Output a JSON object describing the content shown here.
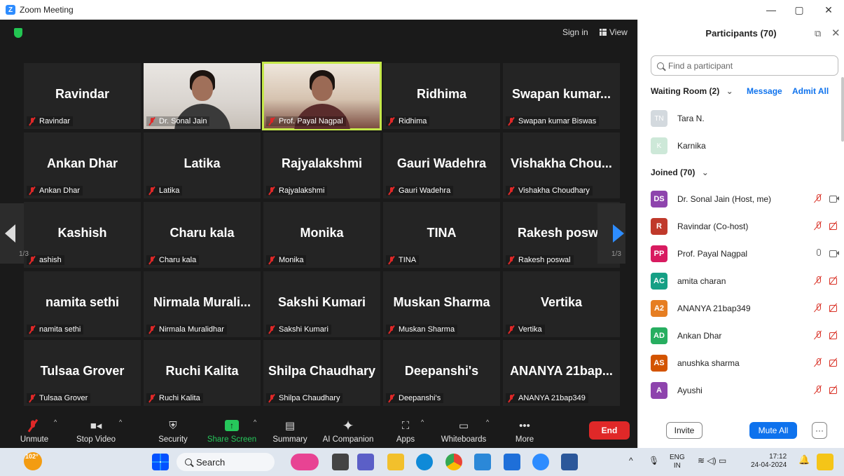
{
  "window": {
    "title": "Zoom Meeting",
    "minimize": "—",
    "restore": "▢",
    "close": "✕",
    "logo_letter": "Z"
  },
  "meeting": {
    "sign_in": "Sign in",
    "view": "View",
    "page_indicator": "1/3",
    "tiles": [
      {
        "big": "Ravindar",
        "name": "Ravindar"
      },
      {
        "big": "",
        "name": "Dr. Sonal Jain",
        "video": true
      },
      {
        "big": "",
        "name": "Prof. Payal Nagpal",
        "video": true
      },
      {
        "big": "Ridhima",
        "name": "Ridhima"
      },
      {
        "big": "Swapan  kumar...",
        "name": "Swapan kumar Biswas"
      },
      {
        "big": "Ankan Dhar",
        "name": "Ankan Dhar"
      },
      {
        "big": "Latika",
        "name": "Latika"
      },
      {
        "big": "Rajyalakshmi",
        "name": "Rajyalakshmi"
      },
      {
        "big": "Gauri Wadehra",
        "name": "Gauri Wadehra"
      },
      {
        "big": "Vishakha  Chou...",
        "name": "Vishakha Choudhary"
      },
      {
        "big": "Kashish",
        "name": "ashish"
      },
      {
        "big": "Charu kala",
        "name": "Charu kala"
      },
      {
        "big": "Monika",
        "name": "Monika"
      },
      {
        "big": "TINA",
        "name": "TINA"
      },
      {
        "big": "Rakesh  poswa",
        "name": "Rakesh poswal"
      },
      {
        "big": "namita sethi",
        "name": "namita sethi"
      },
      {
        "big": "Nirmala  Murali...",
        "name": "Nirmala Muralidhar"
      },
      {
        "big": "Sakshi Kumari",
        "name": "Sakshi Kumari"
      },
      {
        "big": "Muskan Sharma",
        "name": "Muskan Sharma"
      },
      {
        "big": "Vertika",
        "name": "Vertika"
      },
      {
        "big": "Tulsaa Grover",
        "name": "Tulsaa Grover"
      },
      {
        "big": "Ruchi Kalita",
        "name": "Ruchi Kalita"
      },
      {
        "big": "Shilpa Chaudhary",
        "name": "Shilpa Chaudhary"
      },
      {
        "big": "Deepanshi's",
        "name": "Deepanshi's"
      },
      {
        "big": "ANANYA  21bap...",
        "name": "ANANYA 21bap349"
      }
    ]
  },
  "toolbar": {
    "unmute": "Unmute",
    "stop_video": "Stop Video",
    "security": "Security",
    "share_screen": "Share Screen",
    "summary": "Summary",
    "ai_companion": "AI Companion",
    "apps": "Apps",
    "whiteboards": "Whiteboards",
    "more": "More",
    "end": "End"
  },
  "participants": {
    "title": "Participants (70)",
    "search_placeholder": "Find a participant",
    "waiting_room": "Waiting Room (2)",
    "message": "Message",
    "admit_all": "Admit All",
    "waiting": [
      {
        "initials": "TN",
        "name": "Tara N.",
        "color": "#d3d9de"
      },
      {
        "initials": "K",
        "name": "Karnika",
        "color": "#cde8d8"
      }
    ],
    "joined_label": "Joined (70)",
    "joined": [
      {
        "initials": "DS",
        "name": "Dr. Sonal Jain (Host, me)",
        "color": "#8e44ad",
        "mic": "off",
        "cam": "on"
      },
      {
        "initials": "R",
        "name": "Ravindar (Co-host)",
        "color": "#c0392b",
        "mic": "off",
        "cam": "off"
      },
      {
        "initials": "PP",
        "name": "Prof. Payal Nagpal",
        "color": "#d81b60",
        "mic": "on",
        "cam": "on"
      },
      {
        "initials": "AC",
        "name": "amita charan",
        "color": "#16a085",
        "mic": "off",
        "cam": "off"
      },
      {
        "initials": "A2",
        "name": "ANANYA 21bap349",
        "color": "#e67e22",
        "mic": "off",
        "cam": "off"
      },
      {
        "initials": "AD",
        "name": "Ankan Dhar",
        "color": "#27ae60",
        "mic": "off",
        "cam": "off"
      },
      {
        "initials": "AS",
        "name": "anushka sharma",
        "color": "#d35400",
        "mic": "off",
        "cam": "off"
      },
      {
        "initials": "A",
        "name": "Ayushi",
        "color": "#8e44ad",
        "mic": "off",
        "cam": "off"
      }
    ],
    "invite": "Invite",
    "mute_all": "Mute All",
    "more": "···"
  },
  "taskbar": {
    "weather": "102°",
    "search": "Search",
    "lang": "ENG",
    "region": "IN",
    "time": "17:12",
    "date": "24-04-2024"
  },
  "colors": {
    "accent": "#0e72ed",
    "end": "#e02828",
    "share": "#26c75b",
    "highlight": "#c5e84a"
  }
}
